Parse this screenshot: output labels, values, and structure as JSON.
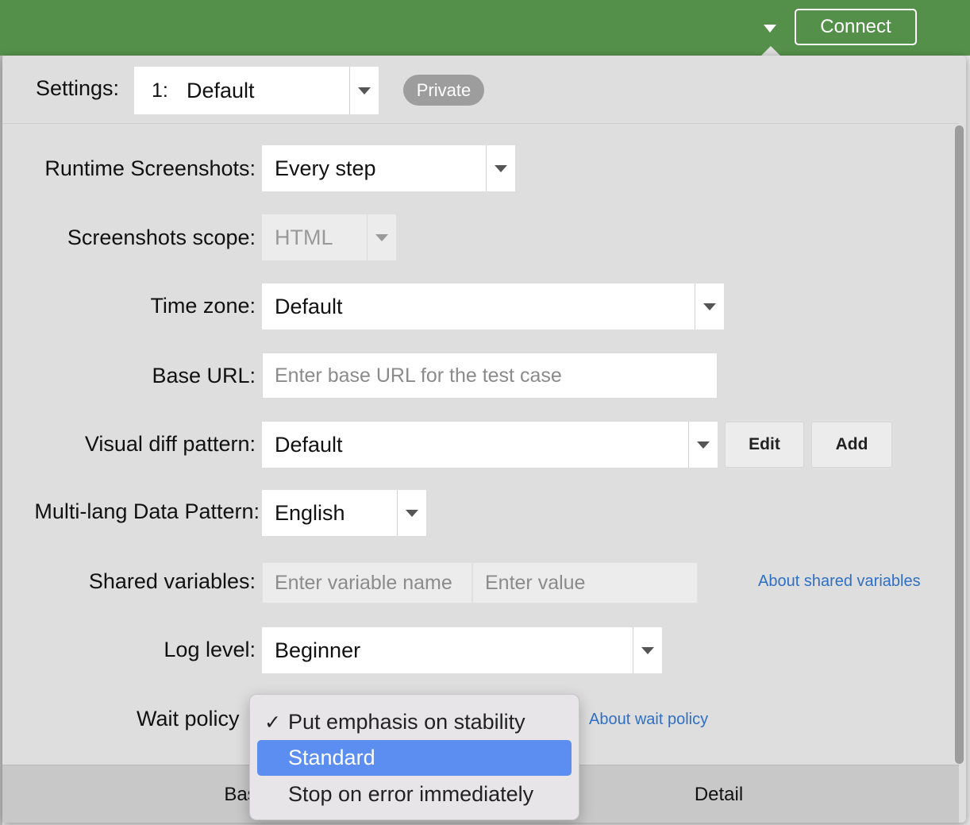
{
  "topbar": {
    "connect_label": "Connect"
  },
  "settings": {
    "label": "Settings:",
    "number": "1:",
    "value": "Default",
    "visibility_badge": "Private"
  },
  "fields": {
    "runtime_screenshots": {
      "label": "Runtime Screenshots:",
      "value": "Every step"
    },
    "screenshots_scope": {
      "label": "Screenshots scope:",
      "value": "HTML"
    },
    "time_zone": {
      "label": "Time zone:",
      "value": "Default"
    },
    "base_url": {
      "label": "Base URL:",
      "placeholder": "Enter base URL for the test case"
    },
    "visual_diff": {
      "label": "Visual diff pattern:",
      "value": "Default",
      "edit_label": "Edit",
      "add_label": "Add"
    },
    "multi_lang": {
      "label": "Multi-lang Data Pattern:",
      "value": "English"
    },
    "shared_vars": {
      "label": "Shared variables:",
      "name_placeholder": "Enter variable name",
      "value_placeholder": "Enter value",
      "help_link": "About shared variables"
    },
    "log_level": {
      "label": "Log level:",
      "value": "Beginner"
    },
    "wait_policy": {
      "label": "Wait policy",
      "help_link": "About wait policy"
    }
  },
  "wait_policy_menu": {
    "options": [
      {
        "label": "Put emphasis on stability",
        "check": "✓"
      },
      {
        "label": "Standard"
      },
      {
        "label": "Stop on error immediately"
      }
    ],
    "checked_option": "Put emphasis on stability",
    "highlighted_option": "Standard"
  },
  "tabs": [
    {
      "label": "Bas"
    },
    {
      "label": "Detail"
    }
  ],
  "colors": {
    "topbar": "#55904a",
    "highlight": "#5b8ef0",
    "link": "#2f6fc4",
    "badge": "#9d9d9d"
  },
  "icons": [
    "caret-down-icon",
    "checkmark-icon"
  ]
}
